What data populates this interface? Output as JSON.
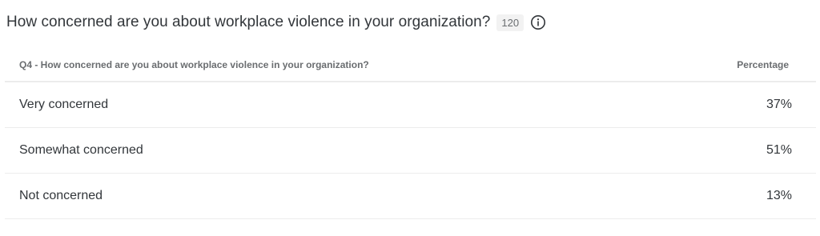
{
  "header": {
    "title": "How concerned are you about workplace violence in your organization?",
    "response_count": "120",
    "info_icon": "info-circle-icon"
  },
  "table": {
    "columns": {
      "question": "Q4 - How concerned are you about workplace violence in your organization?",
      "percentage": "Percentage"
    },
    "rows": [
      {
        "label": "Very concerned",
        "value": "37%"
      },
      {
        "label": "Somewhat concerned",
        "value": "51%"
      },
      {
        "label": "Not concerned",
        "value": "13%"
      }
    ]
  }
}
